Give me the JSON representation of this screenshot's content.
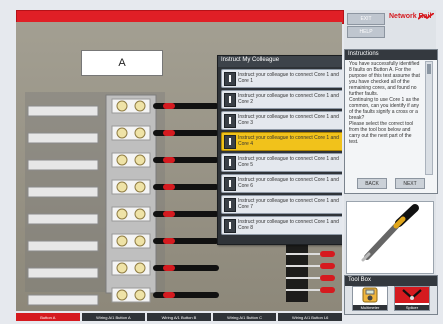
{
  "stage": {
    "panel_label": "A"
  },
  "menu": {
    "title": "Instruct My Colleague",
    "items": [
      {
        "label": "Instruct your colleague to connect Core 1 and Core 1"
      },
      {
        "label": "Instruct your colleague to connect Core 1 and Core 2"
      },
      {
        "label": "Instruct your colleague to connect Core 1 and Core 3"
      },
      {
        "label": "Instruct your colleague to connect Core 1 and Core 4"
      },
      {
        "label": "Instruct your colleague to connect Core 1 and Core 5"
      },
      {
        "label": "Instruct your colleague to connect Core 1 and Core 6"
      },
      {
        "label": "Instruct your colleague to connect Core 1 and Core 7"
      },
      {
        "label": "Instruct your colleague to connect Core 1 and Core 8"
      }
    ],
    "active_index": 3
  },
  "header_buttons": {
    "exit": "EXIT",
    "help": "HELP"
  },
  "logo": {
    "text": "Network Rail"
  },
  "instructions": {
    "title": "Instructions",
    "body": "You have successfully identified 8 faults on Button A. For the purpose of this test assume that you have checked all of the remaining cores, and found no further faults.\nContinuing to use Core 1 as the common, can you identify if any of the faults signify a cross or a break?\nPlease select the correct tool from the tool box below and carry out the next part of the test.",
    "back": "BACK",
    "next": "NEXT"
  },
  "toolbox": {
    "title": "Tool Box",
    "tools": [
      {
        "label": "Multimeter"
      },
      {
        "label": "Splicer"
      }
    ]
  },
  "tabs": [
    {
      "label": "Button A"
    },
    {
      "label": "Wiring A/1 Button A"
    },
    {
      "label": "Wiring A/1 Button B"
    },
    {
      "label": "Wiring A/1 Button C"
    },
    {
      "label": "Wiring A/1 Button L6"
    }
  ],
  "colors": {
    "accent_red": "#d51a1f",
    "highlight_yellow": "#f1c21b",
    "dark_panel": "#2f3338"
  }
}
